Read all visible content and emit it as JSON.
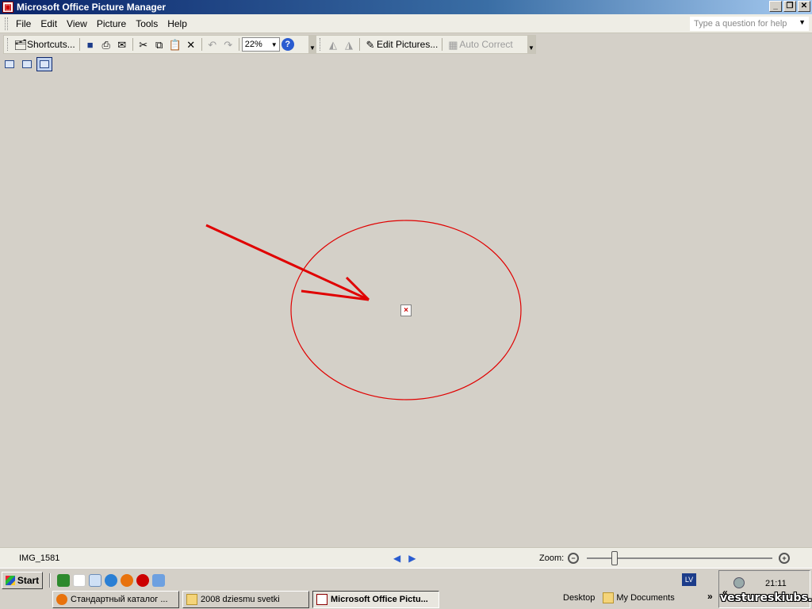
{
  "window": {
    "title": "Microsoft Office Picture Manager"
  },
  "menu": {
    "items": [
      "File",
      "Edit",
      "View",
      "Picture",
      "Tools",
      "Help"
    ],
    "help_placeholder": "Type a question for help"
  },
  "toolbar": {
    "shortcuts_label": "Shortcuts...",
    "zoom_value": "22%",
    "edit_pictures_label": "Edit Pictures...",
    "auto_correct_label": "Auto Correct"
  },
  "status": {
    "file_name": "IMG_1581",
    "zoom_label": "Zoom:",
    "zoom_level": 0.15
  },
  "taskbar": {
    "start_label": "Start",
    "tasks": [
      {
        "label": "Стандартный каталог ...",
        "active": false
      },
      {
        "label": "2008 dziesmu svetki",
        "active": false
      },
      {
        "label": "Microsoft Office Pictu...",
        "active": true
      }
    ],
    "lang": "LV",
    "desktop_label": "Desktop",
    "my_documents_label": "My Documents",
    "clock": "21:11"
  },
  "watermark": "vestureskiubs.lv",
  "colors": {
    "annotation": "#e00000",
    "title_bar": "#0a246a"
  }
}
